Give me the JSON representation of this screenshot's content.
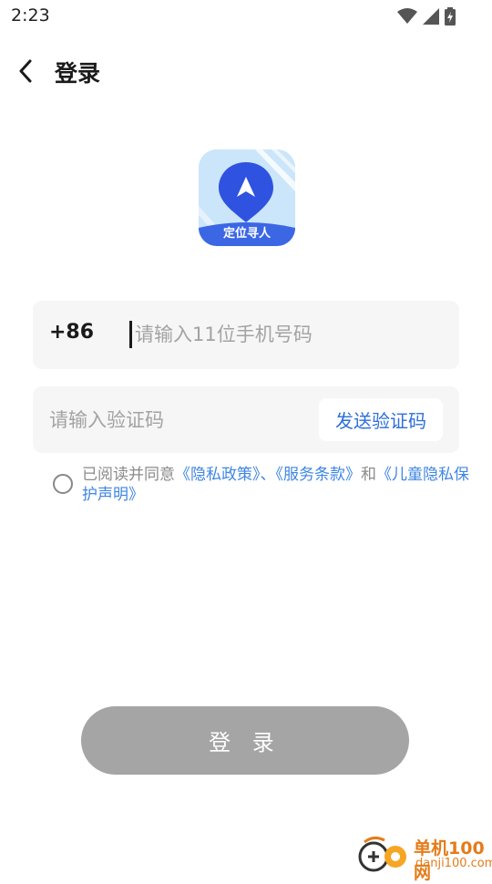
{
  "status_bar": {
    "time": "2:23"
  },
  "nav": {
    "title": "登录"
  },
  "logo": {
    "label": "定位寻人"
  },
  "phone": {
    "prefix": "+86",
    "placeholder": "请输入11位手机号码",
    "value": ""
  },
  "code": {
    "placeholder": "请输入验证码",
    "value": "",
    "send_label": "发送验证码"
  },
  "agreement": {
    "prefix": "已阅读并同意",
    "privacy": "《隐私政策》",
    "sep": "、",
    "terms": "《服务条款》",
    "and": "和",
    "children": "《儿童隐私保护声明》",
    "checked": false
  },
  "login": {
    "label": "登 录"
  },
  "watermark": {
    "title": "单机100网",
    "site": "danji100.com"
  },
  "colors": {
    "accent": "#2d6fd9",
    "link": "#3f86e3",
    "button_disabled": "#a5a5a5",
    "field_bg": "#f6f6f6"
  }
}
